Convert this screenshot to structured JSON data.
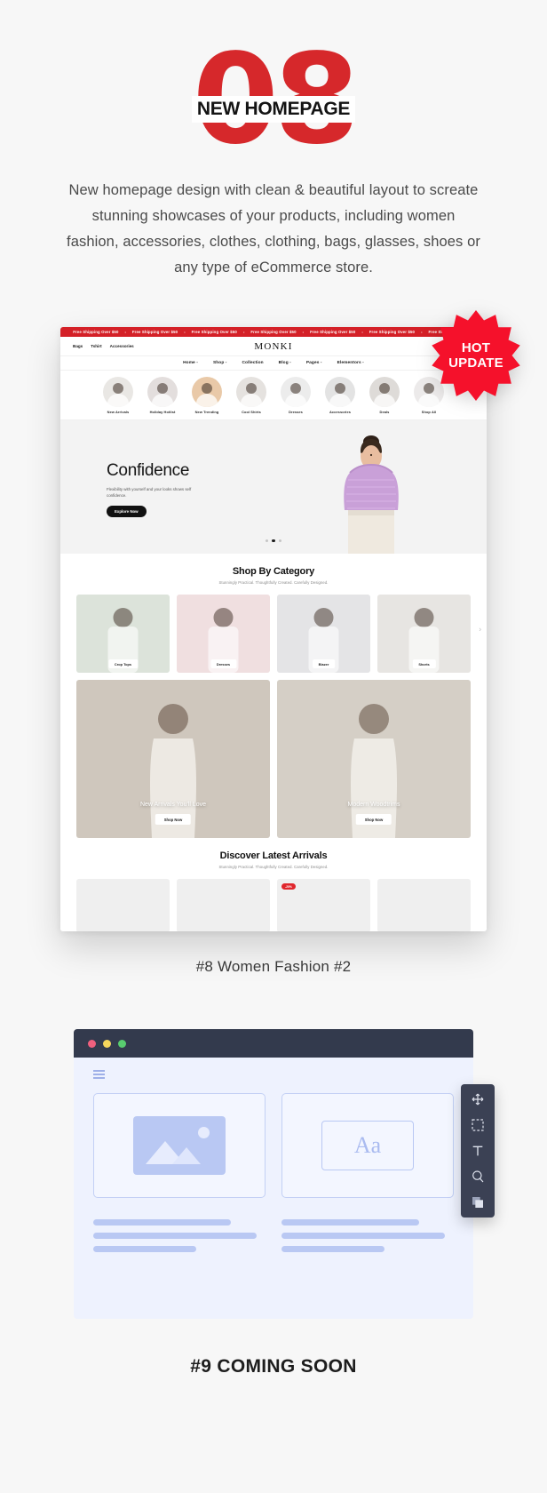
{
  "hero": {
    "number": "08",
    "label": "NEW HOMEPAGE",
    "accent_color": "#d6282b",
    "description": "New homepage design with clean & beautiful layout to screate stunning showcases of your products, including women fashion, accessories, clothes, clothing, bags, glasses, shoes or any type of eCommerce store."
  },
  "badge": {
    "line1": "HOT",
    "line2": "UPDATE",
    "color": "#f5112b"
  },
  "mockup": {
    "announcement": {
      "message": "Free Shipping Over $50",
      "separator": "•",
      "repeat": 7,
      "bg_color": "#d42027"
    },
    "brand": "MONKI",
    "mini_links": [
      "Bags",
      "Tshirt",
      "Accessories"
    ],
    "header_icons": [
      "user-icon",
      "search-icon",
      "heart-icon"
    ],
    "nav": [
      {
        "label": "Home -"
      },
      {
        "label": "Shop -"
      },
      {
        "label": "Collection"
      },
      {
        "label": "Blog -"
      },
      {
        "label": "Pages -"
      },
      {
        "label": "Elementors -"
      }
    ],
    "categories": [
      {
        "label": "New Arrivals",
        "bg": "#e9e7e4"
      },
      {
        "label": "Holiday Hotlist",
        "bg": "#e3dedd"
      },
      {
        "label": "New Trending",
        "bg": "#e9c9a8"
      },
      {
        "label": "Cool Shirts",
        "bg": "#e5e2df"
      },
      {
        "label": "Dresses",
        "bg": "#ececec"
      },
      {
        "label": "Accessories",
        "bg": "#e3e3e3"
      },
      {
        "label": "Deals",
        "bg": "#dedbd8"
      },
      {
        "label": "Shop All",
        "bg": "#eceaea"
      }
    ],
    "hero_slide": {
      "title": "Confidence",
      "subtitle": "Flexibility with yourself and your looks shows self confidence.",
      "button": "Explore Now",
      "dots": 3,
      "active_dot": 2
    },
    "shop_by_category": {
      "title": "Shop By Category",
      "subtitle": "Stunningly Practical. Thoughtfully Created. Carefully Designed.",
      "cards": [
        {
          "label": "Crop Tops",
          "bg": "#dce3da"
        },
        {
          "label": "Dresses",
          "bg": "#f0dfe0"
        },
        {
          "label": "Blazer",
          "bg": "#e4e4e6"
        },
        {
          "label": "Shorts",
          "bg": "#e7e5e2"
        }
      ],
      "arrow": "›"
    },
    "promos": [
      {
        "title": "New Arrivals You'll Love",
        "button": "Shop Now",
        "bg": "#cfc7bd"
      },
      {
        "title": "Modern Woodtrims",
        "button": "Shop Now",
        "bg": "#d5cfc6"
      }
    ],
    "latest": {
      "title": "Discover Latest Arrivals",
      "subtitle": "Stunningly Practical. Thoughtfully Created. Carefully Designed.",
      "products": [
        {
          "badge": ""
        },
        {
          "badge": ""
        },
        {
          "badge": "-20%"
        },
        {
          "badge": ""
        }
      ]
    }
  },
  "shot_caption": "#8 Women Fashion #2",
  "coming_soon": {
    "window_dots": [
      "#f0607e",
      "#f5d65c",
      "#58cc6f"
    ],
    "menu_icon": "hamburger-icon",
    "placeholder_image_icon": "image-placeholder-icon",
    "placeholder_text_icon": "Aa",
    "tools": [
      "move-icon",
      "select-icon",
      "text-icon",
      "zoom-icon",
      "layers-icon"
    ],
    "caption": "#9 COMING SOON"
  }
}
